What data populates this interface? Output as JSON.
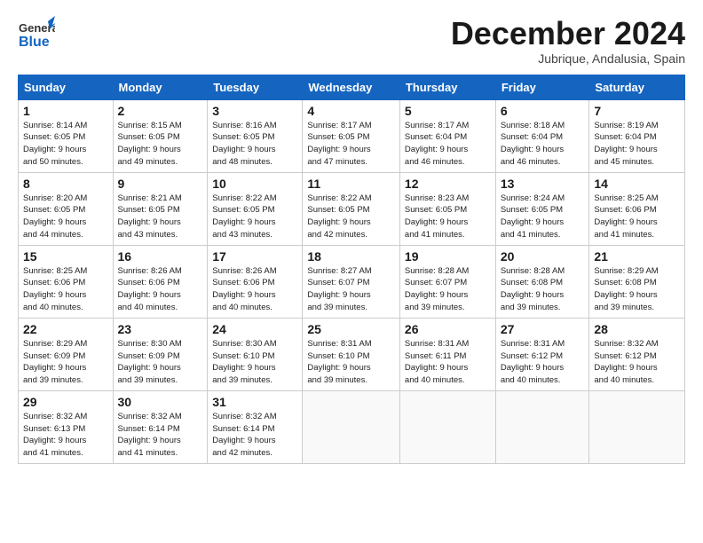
{
  "header": {
    "logo_general": "General",
    "logo_blue": "Blue",
    "month_title": "December 2024",
    "location": "Jubrique, Andalusia, Spain"
  },
  "weekdays": [
    "Sunday",
    "Monday",
    "Tuesday",
    "Wednesday",
    "Thursday",
    "Friday",
    "Saturday"
  ],
  "weeks": [
    [
      {
        "day": "1",
        "info": "Sunrise: 8:14 AM\nSunset: 6:05 PM\nDaylight: 9 hours\nand 50 minutes."
      },
      {
        "day": "2",
        "info": "Sunrise: 8:15 AM\nSunset: 6:05 PM\nDaylight: 9 hours\nand 49 minutes."
      },
      {
        "day": "3",
        "info": "Sunrise: 8:16 AM\nSunset: 6:05 PM\nDaylight: 9 hours\nand 48 minutes."
      },
      {
        "day": "4",
        "info": "Sunrise: 8:17 AM\nSunset: 6:05 PM\nDaylight: 9 hours\nand 47 minutes."
      },
      {
        "day": "5",
        "info": "Sunrise: 8:17 AM\nSunset: 6:04 PM\nDaylight: 9 hours\nand 46 minutes."
      },
      {
        "day": "6",
        "info": "Sunrise: 8:18 AM\nSunset: 6:04 PM\nDaylight: 9 hours\nand 46 minutes."
      },
      {
        "day": "7",
        "info": "Sunrise: 8:19 AM\nSunset: 6:04 PM\nDaylight: 9 hours\nand 45 minutes."
      }
    ],
    [
      {
        "day": "8",
        "info": "Sunrise: 8:20 AM\nSunset: 6:05 PM\nDaylight: 9 hours\nand 44 minutes."
      },
      {
        "day": "9",
        "info": "Sunrise: 8:21 AM\nSunset: 6:05 PM\nDaylight: 9 hours\nand 43 minutes."
      },
      {
        "day": "10",
        "info": "Sunrise: 8:22 AM\nSunset: 6:05 PM\nDaylight: 9 hours\nand 43 minutes."
      },
      {
        "day": "11",
        "info": "Sunrise: 8:22 AM\nSunset: 6:05 PM\nDaylight: 9 hours\nand 42 minutes."
      },
      {
        "day": "12",
        "info": "Sunrise: 8:23 AM\nSunset: 6:05 PM\nDaylight: 9 hours\nand 41 minutes."
      },
      {
        "day": "13",
        "info": "Sunrise: 8:24 AM\nSunset: 6:05 PM\nDaylight: 9 hours\nand 41 minutes."
      },
      {
        "day": "14",
        "info": "Sunrise: 8:25 AM\nSunset: 6:06 PM\nDaylight: 9 hours\nand 41 minutes."
      }
    ],
    [
      {
        "day": "15",
        "info": "Sunrise: 8:25 AM\nSunset: 6:06 PM\nDaylight: 9 hours\nand 40 minutes."
      },
      {
        "day": "16",
        "info": "Sunrise: 8:26 AM\nSunset: 6:06 PM\nDaylight: 9 hours\nand 40 minutes."
      },
      {
        "day": "17",
        "info": "Sunrise: 8:26 AM\nSunset: 6:06 PM\nDaylight: 9 hours\nand 40 minutes."
      },
      {
        "day": "18",
        "info": "Sunrise: 8:27 AM\nSunset: 6:07 PM\nDaylight: 9 hours\nand 39 minutes."
      },
      {
        "day": "19",
        "info": "Sunrise: 8:28 AM\nSunset: 6:07 PM\nDaylight: 9 hours\nand 39 minutes."
      },
      {
        "day": "20",
        "info": "Sunrise: 8:28 AM\nSunset: 6:08 PM\nDaylight: 9 hours\nand 39 minutes."
      },
      {
        "day": "21",
        "info": "Sunrise: 8:29 AM\nSunset: 6:08 PM\nDaylight: 9 hours\nand 39 minutes."
      }
    ],
    [
      {
        "day": "22",
        "info": "Sunrise: 8:29 AM\nSunset: 6:09 PM\nDaylight: 9 hours\nand 39 minutes."
      },
      {
        "day": "23",
        "info": "Sunrise: 8:30 AM\nSunset: 6:09 PM\nDaylight: 9 hours\nand 39 minutes."
      },
      {
        "day": "24",
        "info": "Sunrise: 8:30 AM\nSunset: 6:10 PM\nDaylight: 9 hours\nand 39 minutes."
      },
      {
        "day": "25",
        "info": "Sunrise: 8:31 AM\nSunset: 6:10 PM\nDaylight: 9 hours\nand 39 minutes."
      },
      {
        "day": "26",
        "info": "Sunrise: 8:31 AM\nSunset: 6:11 PM\nDaylight: 9 hours\nand 40 minutes."
      },
      {
        "day": "27",
        "info": "Sunrise: 8:31 AM\nSunset: 6:12 PM\nDaylight: 9 hours\nand 40 minutes."
      },
      {
        "day": "28",
        "info": "Sunrise: 8:32 AM\nSunset: 6:12 PM\nDaylight: 9 hours\nand 40 minutes."
      }
    ],
    [
      {
        "day": "29",
        "info": "Sunrise: 8:32 AM\nSunset: 6:13 PM\nDaylight: 9 hours\nand 41 minutes."
      },
      {
        "day": "30",
        "info": "Sunrise: 8:32 AM\nSunset: 6:14 PM\nDaylight: 9 hours\nand 41 minutes."
      },
      {
        "day": "31",
        "info": "Sunrise: 8:32 AM\nSunset: 6:14 PM\nDaylight: 9 hours\nand 42 minutes."
      },
      null,
      null,
      null,
      null
    ]
  ]
}
